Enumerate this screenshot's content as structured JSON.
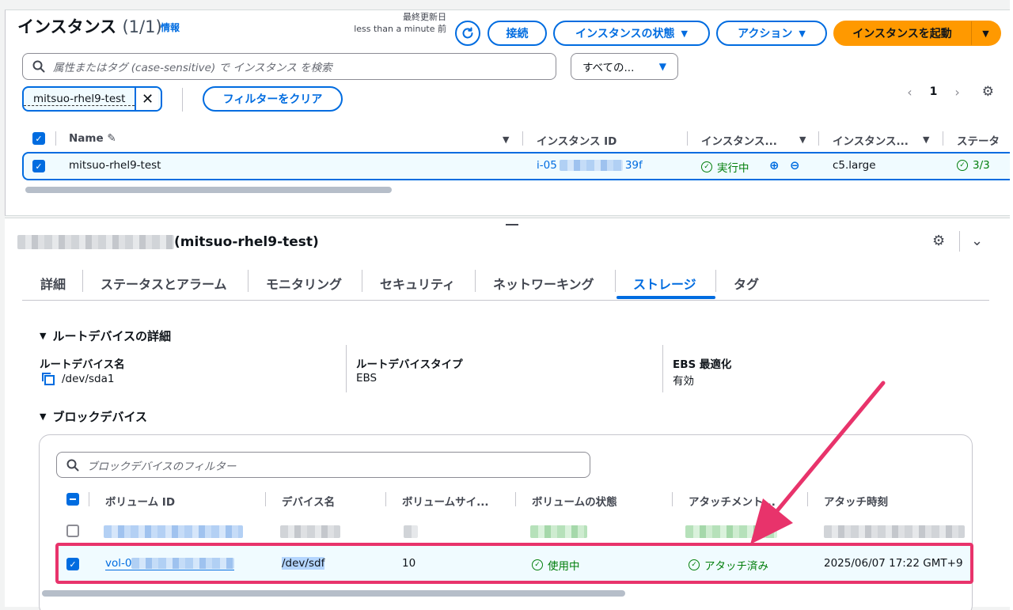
{
  "instances": {
    "title": "インスタンス",
    "count": "(1/1)",
    "info_link": "情報",
    "last_updated_label": "最終更新日",
    "last_updated_value": "less than a minute 前",
    "buttons": {
      "connect": "接続",
      "instance_state": "インスタンスの状態",
      "actions": "アクション",
      "launch": "インスタンスを起動"
    },
    "search_placeholder": "属性またはタグ (case-sensitive) で インスタンス を検索",
    "state_select": "すべての...",
    "filter_token": "mitsuo-rhel9-test",
    "clear_filters": "フィルターをクリア",
    "page": "1",
    "columns": [
      "Name",
      "インスタンス ID",
      "インスタンス...",
      "インスタンス...",
      "ステータ"
    ],
    "row": {
      "name": "mitsuo-rhel9-test",
      "instance_id_prefix": "i-05",
      "instance_id_suffix": "39f",
      "state": "実行中",
      "type": "c5.large",
      "status_check": "3/3"
    }
  },
  "details": {
    "title": "(mitsuo-rhel9-test)",
    "tabs": [
      "詳細",
      "ステータスとアラーム",
      "モニタリング",
      "セキュリティ",
      "ネットワーキング",
      "ストレージ",
      "タグ"
    ],
    "active_tab": "ストレージ",
    "root_section": "ルートデバイスの詳細",
    "root": {
      "device_name_label": "ルートデバイス名",
      "device_name": "/dev/sda1",
      "device_type_label": "ルートデバイスタイプ",
      "device_type": "EBS",
      "ebs_opt_label": "EBS 最適化",
      "ebs_opt": "有効"
    },
    "block_section": "ブロックデバイス",
    "block_filter_placeholder": "ブロックデバイスのフィルター",
    "block_columns": [
      "ボリューム ID",
      "デバイス名",
      "ボリュームサイ...",
      "ボリュームの状態",
      "アタッチメント...",
      "アタッチ時刻"
    ],
    "selected_row": {
      "volume_id_prefix": "vol-0",
      "device": "/dev/sdf",
      "size": "10",
      "volume_state": "使用中",
      "attachment": "アタッチ済み",
      "attach_time": "2025/06/07 17:22 GMT+9"
    }
  },
  "colors": {
    "primary": "#006ce0",
    "launch_button": "#ff9900",
    "success": "#037f0c",
    "annotation": "#e8336b"
  }
}
